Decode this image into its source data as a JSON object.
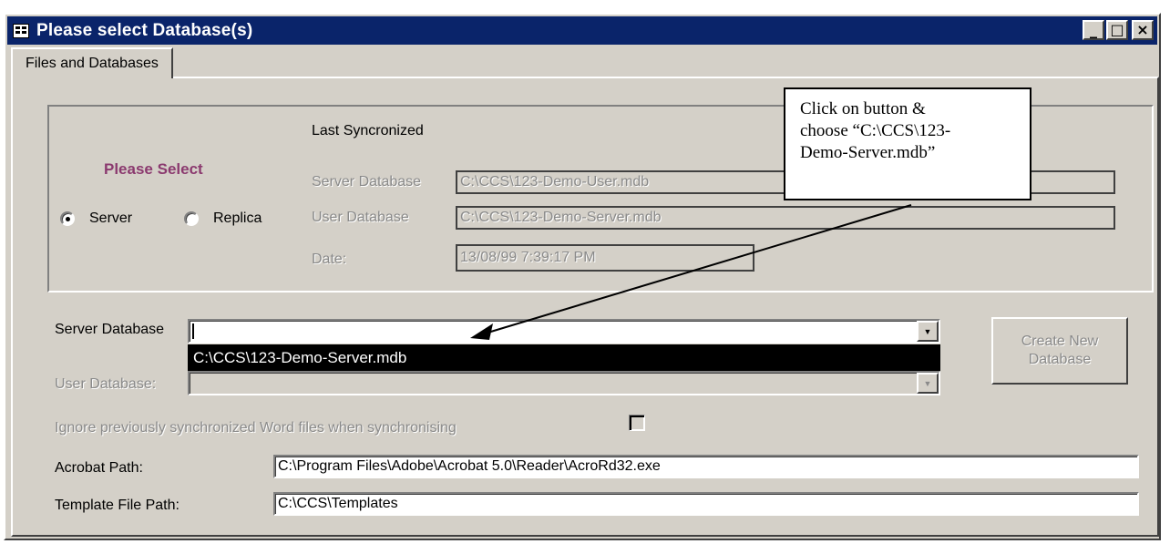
{
  "window": {
    "title": "Please select Database(s)",
    "controls": {
      "minimize": "_",
      "maximize": "□",
      "close": "×"
    }
  },
  "tabs": [
    {
      "label": "Files and Databases",
      "active": true
    }
  ],
  "sync_group": {
    "heading": "Please Select",
    "radios": [
      {
        "label": "Server",
        "checked": true
      },
      {
        "label": "Replica",
        "checked": false
      }
    ],
    "last_sync_label": "Last Syncronized",
    "server_db_label": "Server Database",
    "server_db_value": "C:\\CCS\\123-Demo-User.mdb",
    "user_db_label": "User Database",
    "user_db_value": "C:\\CCS\\123-Demo-Server.mdb",
    "date_label": "Date:",
    "date_value": "13/08/99 7:39:17 PM"
  },
  "form": {
    "server_db_label": "Server Database",
    "server_db_value": "",
    "server_db_dropdown_option": "C:\\CCS\\123-Demo-Server.mdb",
    "user_db_label": "User Database:",
    "user_db_value": "",
    "ignore_label": "Ignore previously synchronized Word files when synchronising",
    "ignore_checked": false,
    "acrobat_label": "Acrobat Path:",
    "acrobat_value": "C:\\Program Files\\Adobe\\Acrobat 5.0\\Reader\\AcroRd32.exe",
    "template_label": "Template File Path:",
    "template_value": "C:\\CCS\\Templates",
    "create_button": {
      "line1": "Create New",
      "line2": "Database"
    }
  },
  "callout": {
    "line1": "Click on button &",
    "line2": "choose “C:\\CCS\\123-",
    "line3": "Demo-Server.mdb”"
  },
  "colors": {
    "title_bar": "#0a246a",
    "heading": "#8b3a6f",
    "face": "#d4d0c8"
  }
}
